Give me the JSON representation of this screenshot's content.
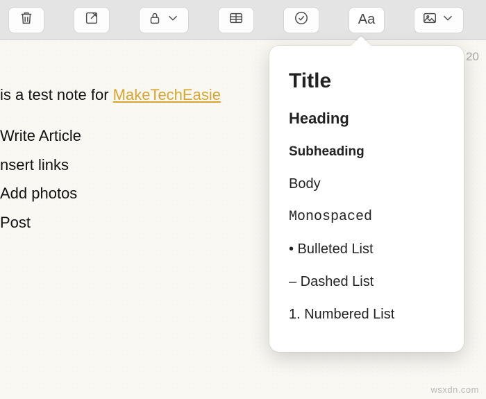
{
  "toolbar": {
    "delete": "Delete",
    "compose": "Compose",
    "lock": "Lock",
    "table": "Table",
    "checklist": "Checklist",
    "format": "Aa",
    "media": "Media"
  },
  "note": {
    "date_fragment": "20",
    "intro_prefix": "is a test note for ",
    "link_text": "MakeTechEasie",
    "items": [
      "Write Article",
      "nsert links",
      "Add photos",
      "Post"
    ]
  },
  "format_menu": {
    "title": "Title",
    "heading": "Heading",
    "subheading": "Subheading",
    "body": "Body",
    "monospaced": "Monospaced",
    "bulleted": "• Bulleted List",
    "dashed": "– Dashed List",
    "numbered": "1. Numbered List"
  },
  "watermark": "wsxdn.com"
}
